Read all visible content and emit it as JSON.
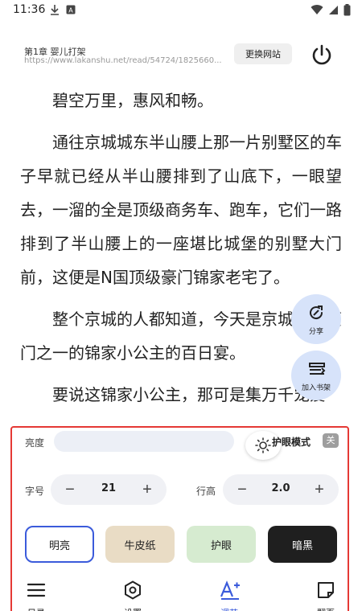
{
  "status_bar": {
    "time": "11:36",
    "icons_left": [
      "download-icon",
      "font-icon"
    ],
    "icons_right": [
      "wifi-icon",
      "signal-icon",
      "battery-icon"
    ]
  },
  "header": {
    "chapter_title": "第1章 婴儿打架",
    "url": "https://www.lakanshu.net/read/54724/1825660...",
    "change_site_label": "更换网站"
  },
  "content": {
    "paragraphs": [
      "碧空万里，惠风和畅。",
      "通往京城城东半山腰上那一片别墅区的车子早就已经从半山腰排到了山底下，一眼望去，一溜的全是顶级商务车、跑车，它们一路排到了半山腰上的一座堪比城堡的别墅大门前，这便是N国顶级豪门锦家老宅了。",
      "整个京城的人都知道，今天是京城四大豪门之一的锦家小公主的百日宴。",
      "要说这锦家小公主，那可是集万千宠爱"
    ]
  },
  "floating": {
    "share_label": "分享",
    "add_shelf_label": "加入书架"
  },
  "settings": {
    "brightness_label": "亮度",
    "brightness_level": 0.88,
    "eye_mode_label": "护眼模式",
    "eye_mode_state": "关",
    "font_size_label": "字号",
    "font_size_value": "21",
    "line_height_label": "行高",
    "line_height_value": "2.0",
    "minus": "−",
    "plus": "+",
    "themes": [
      {
        "label": "明亮",
        "selected": true
      },
      {
        "label": "牛皮纸",
        "selected": false
      },
      {
        "label": "护眼",
        "selected": false
      },
      {
        "label": "暗黑",
        "selected": false
      }
    ],
    "accent_color": "#3b5bdb",
    "highlight_border_color": "#e53935"
  },
  "bottom_nav": [
    {
      "label": "目录",
      "icon": "list-icon"
    },
    {
      "label": "设置",
      "icon": "settings-icon"
    },
    {
      "label": "调节",
      "icon": "text-size-icon",
      "active": true
    },
    {
      "label": "翻页",
      "icon": "page-turn-icon"
    }
  ]
}
